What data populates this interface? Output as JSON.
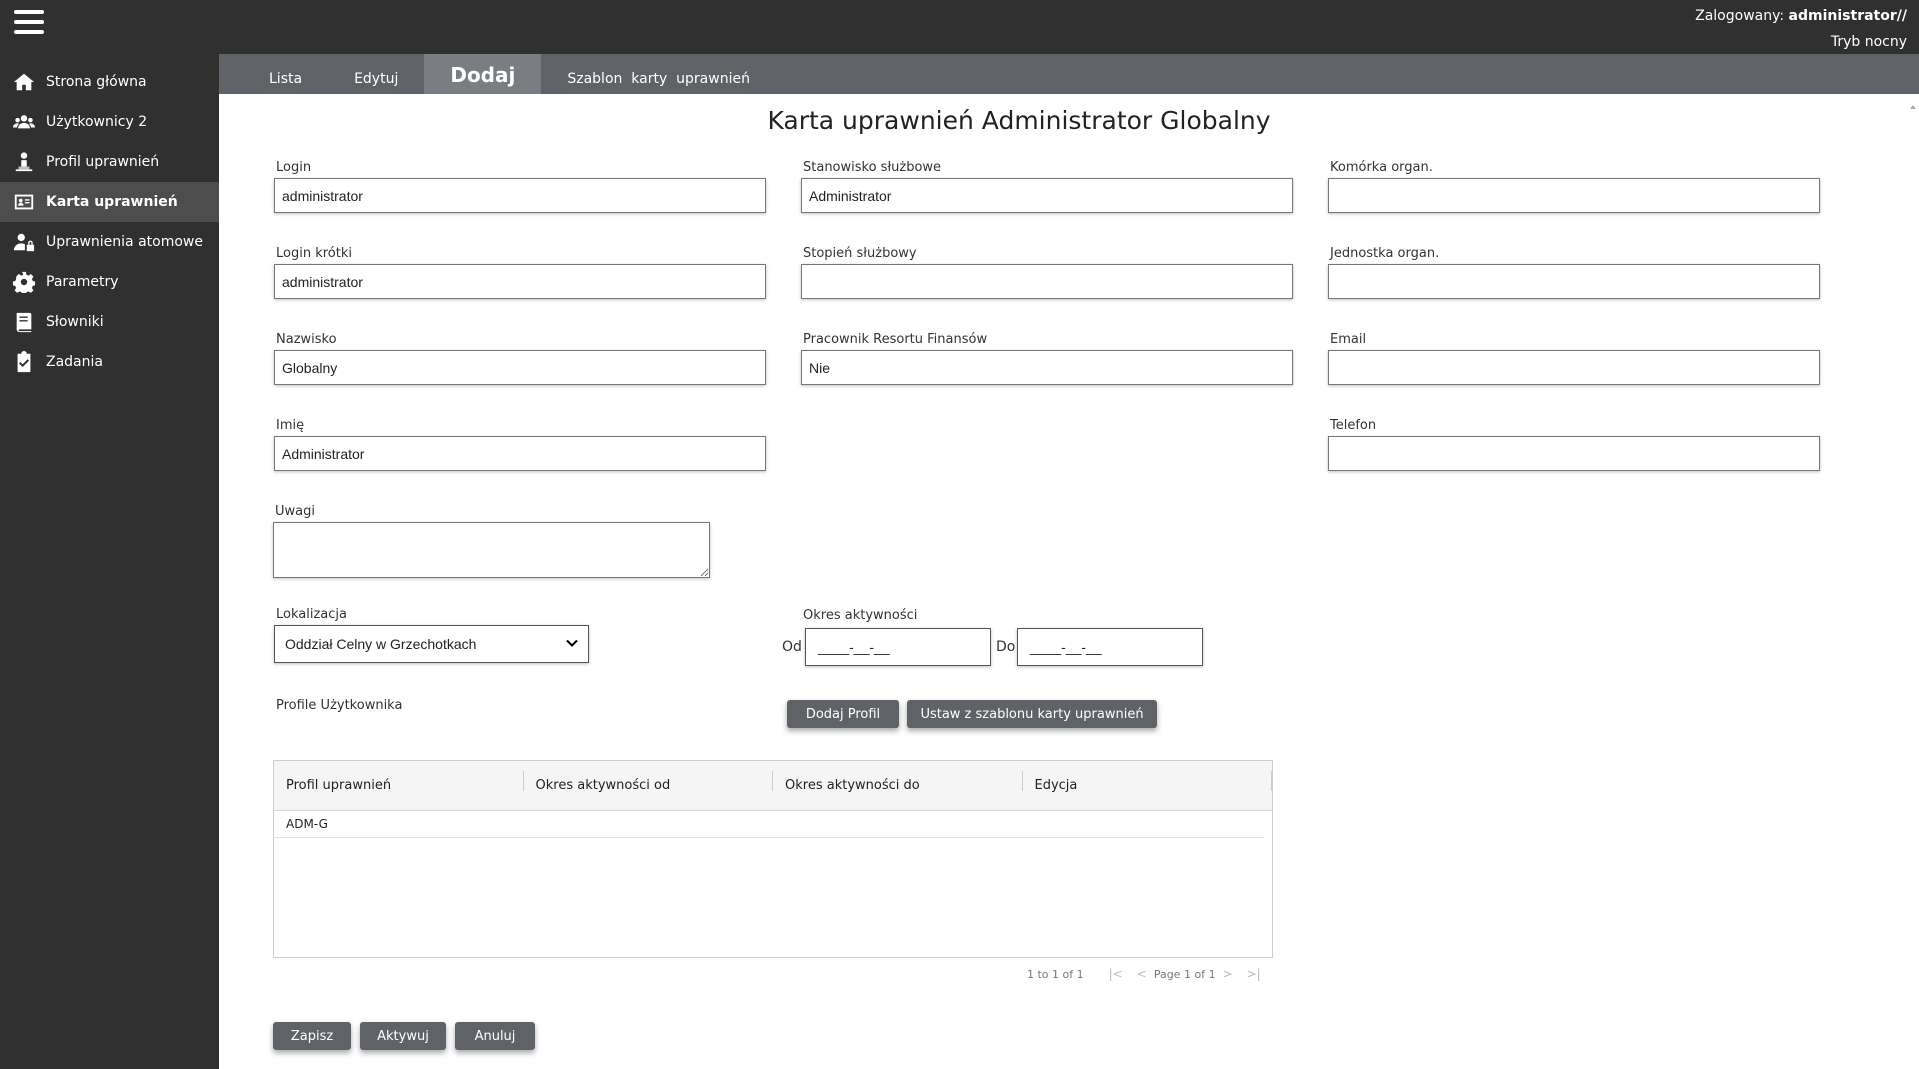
{
  "header": {
    "logged_label": "Zalogowany:",
    "username": "administrator//",
    "night_mode": "Tryb nocny"
  },
  "sidebar": {
    "items": [
      {
        "label": "Strona główna",
        "icon": "home-icon"
      },
      {
        "label": "Użytkownicy 2",
        "icon": "users-icon"
      },
      {
        "label": "Profil uprawnień",
        "icon": "user-profile-icon"
      },
      {
        "label": "Karta uprawnień",
        "icon": "id-card-icon",
        "active": true
      },
      {
        "label": "Uprawnienia atomowe",
        "icon": "user-lock-icon"
      },
      {
        "label": "Parametry",
        "icon": "gear-icon"
      },
      {
        "label": "Słowniki",
        "icon": "book-icon"
      },
      {
        "label": "Zadania",
        "icon": "clipboard-check-icon"
      }
    ]
  },
  "tabs": [
    {
      "label": "Lista"
    },
    {
      "label": "Edytuj"
    },
    {
      "label": "Dodaj",
      "active": true
    },
    {
      "label": "Szablon  karty  uprawnień"
    }
  ],
  "page": {
    "title": "Karta uprawnień Administrator Globalny"
  },
  "form": {
    "login": {
      "label": "Login",
      "value": "administrator"
    },
    "login_short": {
      "label": "Login krótki",
      "value": "administrator"
    },
    "surname": {
      "label": "Nazwisko",
      "value": "Globalny"
    },
    "name": {
      "label": "Imię",
      "value": "Administrator"
    },
    "position": {
      "label": "Stanowisko służbowe",
      "value": "Administrator"
    },
    "rank": {
      "label": "Stopień służbowy",
      "value": ""
    },
    "mf_employee": {
      "label": "Pracownik Resortu Finansów",
      "value": "Nie"
    },
    "org_cell": {
      "label": "Komórka organ.",
      "value": ""
    },
    "org_unit": {
      "label": "Jednostka organ.",
      "value": ""
    },
    "email": {
      "label": "Email",
      "value": ""
    },
    "phone": {
      "label": "Telefon",
      "value": ""
    },
    "notes": {
      "label": "Uwagi",
      "value": ""
    },
    "location": {
      "label": "Lokalizacja",
      "value": "Oddział Celny w Grzechotkach"
    },
    "activity": {
      "label": "Okres aktywności",
      "from_label": "Od",
      "to_label": "Do",
      "from_value": "____-__-__",
      "to_value": "____-__-__"
    }
  },
  "profiles": {
    "label": "Profile Użytkownika",
    "add_button": "Dodaj Profil",
    "template_button": "Ustaw z szablonu karty uprawnień",
    "columns": [
      "Profil uprawnień",
      "Okres aktywności od",
      "Okres aktywności do",
      "Edycja"
    ],
    "rows": [
      {
        "profile": "ADM-G",
        "from": "",
        "to": "",
        "edit": ""
      }
    ],
    "pager": {
      "summary": "1 to 1 of 1",
      "page_label": "Page",
      "page": "1",
      "of_label": "of",
      "total": "1"
    }
  },
  "actions": {
    "save": "Zapisz",
    "activate": "Aktywuj",
    "cancel": "Anuluj"
  }
}
